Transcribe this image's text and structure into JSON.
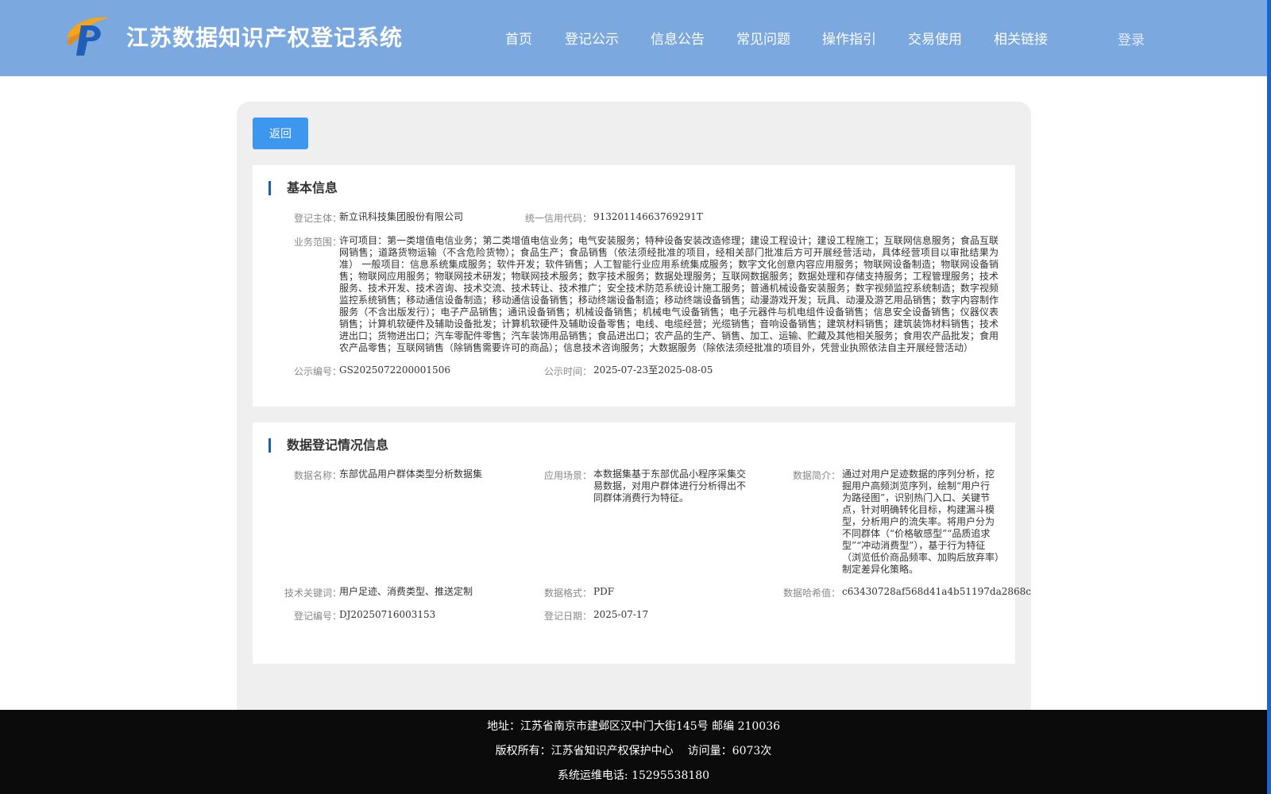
{
  "header": {
    "site_title": "江苏数据知识产权登记系统",
    "nav": [
      "首页",
      "登记公示",
      "信息公告",
      "常见问题",
      "操作指引",
      "交易使用",
      "相关链接"
    ],
    "login": "登录"
  },
  "back_button": "返回",
  "basic_info": {
    "title": "基本信息",
    "registrant_label": "登记主体：",
    "registrant": "新立讯科技集团股份有限公司",
    "credit_code_label": "统一信用代码：",
    "credit_code": "91320114663769291T",
    "business_scope_label": "业务范围：",
    "business_scope": "许可项目：第一类增值电信业务；第二类增值电信业务；电气安装服务；特种设备安装改造修理；建设工程设计；建设工程施工；互联网信息服务；食品互联网销售；道路货物运输（不含危险货物）；食品生产；食品销售（依法须经批准的项目，经相关部门批准后方可开展经营活动，具体经营项目以审批结果为准） 一般项目：信息系统集成服务；软件开发；软件销售；人工智能行业应用系统集成服务；数字文化创意内容应用服务；物联网设备制造；物联网设备销售；物联网应用服务；物联网技术研发；物联网技术服务；数字技术服务；数据处理服务；互联网数据服务；数据处理和存储支持服务；工程管理服务；技术服务、技术开发、技术咨询、技术交流、技术转让、技术推广；安全技术防范系统设计施工服务；普通机械设备安装服务；数字视频监控系统制造；数字视频监控系统销售；移动通信设备制造；移动通信设备销售；移动终端设备制造；移动终端设备销售；动漫游戏开发；玩具、动漫及游艺用品销售；数字内容制作服务（不含出版发行）；电子产品销售；通讯设备销售；机械设备销售；机械电气设备销售；电子元器件与机电组件设备销售；信息安全设备销售；仪器仪表销售；计算机软硬件及辅助设备批发；计算机软硬件及辅助设备零售；电线、电缆经营；光缆销售；音响设备销售；建筑材料销售；建筑装饰材料销售；技术进出口；货物进出口；汽车零配件零售；汽车装饰用品销售；食品进出口；农产品的生产、销售、加工、运输、贮藏及其他相关服务；食用农产品批发；食用农产品零售；互联网销售（除销售需要许可的商品）；信息技术咨询服务；大数据服务（除依法须经批准的项目外，凭营业执照依法自主开展经营活动）",
    "publicity_no_label": "公示编号：",
    "publicity_no": "GS2025072200001506",
    "publicity_time_label": "公示时间：",
    "publicity_time": "2025-07-23至2025-08-05"
  },
  "data_info": {
    "title": "数据登记情况信息",
    "data_name_label": "数据名称：",
    "data_name": "东部优品用户群体类型分析数据集",
    "scenario_label": "应用场景：",
    "scenario": "本数据集基于东部优品小程序采集交易数据，对用户群体进行分析得出不同群体消费行为特征。",
    "summary_label": "数据简介：",
    "summary": "通过对用户足迹数据的序列分析，挖掘用户高频浏览序列，绘制“用户行为路径图”，识别热门入口、关键节点，针对明确转化目标，构建漏斗模型，分析用户的流失率。将用户分为不同群体（“价格敏感型”“品质追求型”“冲动消费型”），基于行为特征（浏览低价商品频率、加购后放弃率）制定差异化策略。",
    "keywords_label": "技术关键词：",
    "keywords": "用户足迹、消费类型、推送定制",
    "format_label": "数据格式：",
    "format": "PDF",
    "hash_label": "数据哈希值：",
    "hash": "c63430728af568d41a4b51197da2868c",
    "reg_no_label": "登记编号：",
    "reg_no": "DJ20250716003153",
    "reg_date_label": "登记日期：",
    "reg_date": "2025-07-17"
  },
  "footer": {
    "address": "地址：江苏省南京市建邺区汉中门大街145号 邮编 210036",
    "copyright": "版权所有：江苏省知识产权保护中心",
    "visits": "访问量：6073次",
    "phone": "系统运维电话: 15295538180"
  },
  "colors": {
    "header_bg": "#7aa8df",
    "accent_button": "#3d97ee",
    "section_bar": "#1c5fb0",
    "footer_bg": "#0b0b0b",
    "right_edge": "#1565d8"
  }
}
